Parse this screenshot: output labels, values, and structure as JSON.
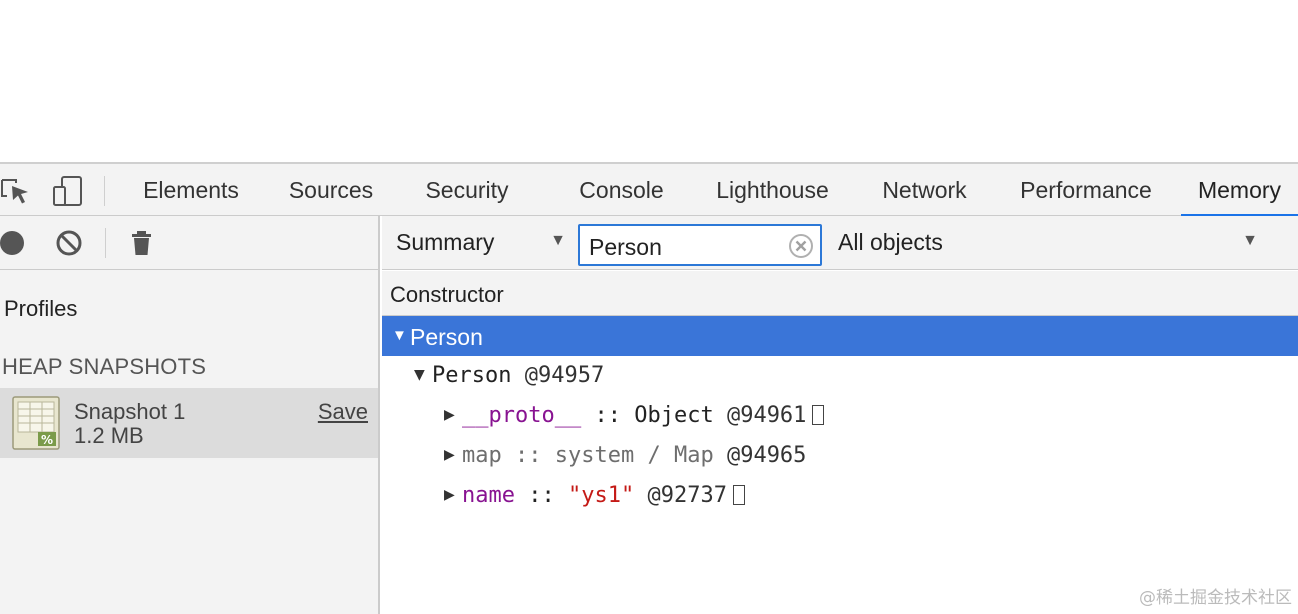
{
  "tabs": [
    {
      "label": "Elements"
    },
    {
      "label": "Sources"
    },
    {
      "label": "Security"
    },
    {
      "label": "Console"
    },
    {
      "label": "Lighthouse"
    },
    {
      "label": "Network"
    },
    {
      "label": "Performance"
    },
    {
      "label": "Memory",
      "active": true
    }
  ],
  "left": {
    "profiles_label": "Profiles",
    "heap_title": "HEAP SNAPSHOTS",
    "snapshot": {
      "name": "Snapshot 1",
      "size": "1.2 MB",
      "save_label": "Save"
    }
  },
  "right": {
    "view_select": "Summary",
    "filter_value": "Person",
    "objects_select": "All objects",
    "column_header": "Constructor",
    "selected_row": "Person",
    "tree": {
      "node": {
        "name": "Person",
        "id": "@94957"
      },
      "children": [
        {
          "name": "__proto__",
          "sep": "::",
          "type": "Object",
          "id": "@94961"
        },
        {
          "name": "map",
          "sep": "::",
          "type": "system / Map",
          "id": "@94965"
        },
        {
          "name": "name",
          "sep": "::",
          "type": "\"ys1\"",
          "id": "@92737"
        }
      ]
    }
  },
  "watermark": "@稀土掘金技术社区",
  "colors": {
    "accent": "#1a73e8",
    "selection": "#3a75d8",
    "property": "#881391",
    "string": "#c41a16"
  }
}
